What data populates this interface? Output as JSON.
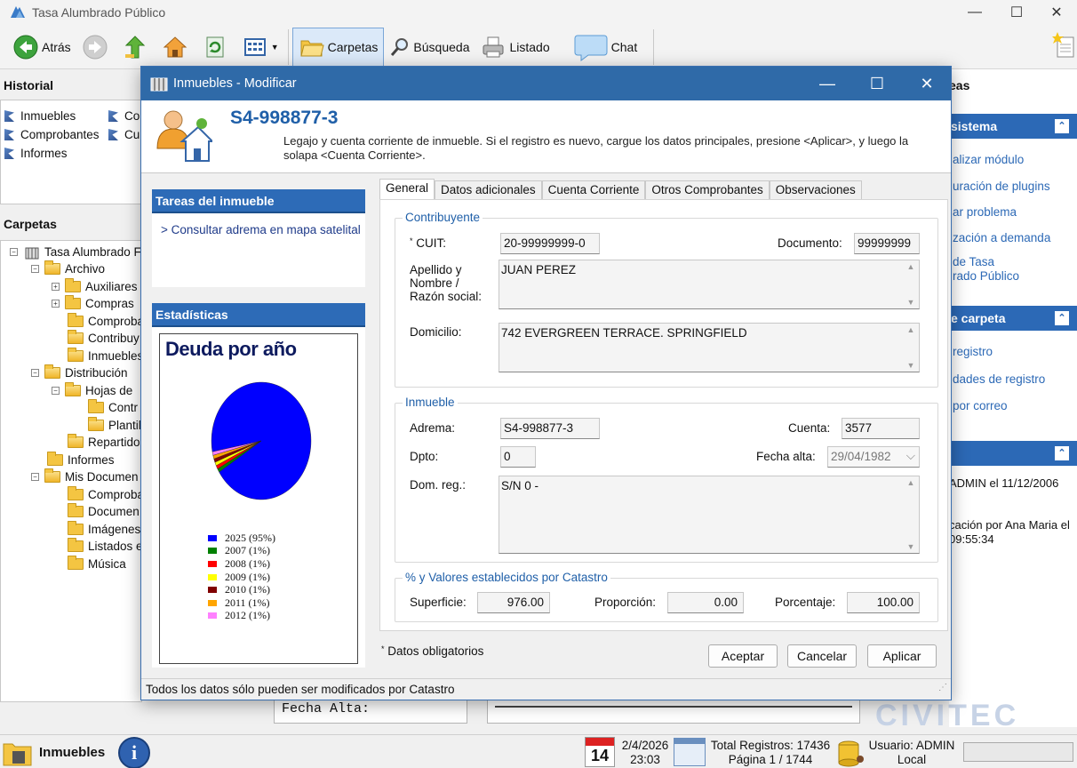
{
  "window": {
    "title": "Tasa Alumbrado Público"
  },
  "toolbar": {
    "back": "Atrás",
    "folders": "Carpetas",
    "search": "Búsqueda",
    "list": "Listado",
    "chat": "Chat"
  },
  "historial": {
    "title": "Historial",
    "items": [
      "Inmuebles",
      "Comprobantes",
      "Informes",
      "Co",
      "Cu"
    ]
  },
  "carpetas": {
    "title": "Carpetas",
    "tree": [
      {
        "label": "Tasa Alumbrado F",
        "expander": "−"
      },
      {
        "label": "Archivo",
        "expander": "−"
      },
      {
        "label": "Auxiliares",
        "expander": "+"
      },
      {
        "label": "Compras",
        "expander": "+"
      },
      {
        "label": "Comproba",
        "expander": ""
      },
      {
        "label": "Contribuy",
        "expander": ""
      },
      {
        "label": "Inmuebles",
        "expander": ""
      },
      {
        "label": "Distribución",
        "expander": "−"
      },
      {
        "label": "Hojas de",
        "expander": "−"
      },
      {
        "label": "Contr",
        "expander": ""
      },
      {
        "label": "Plantil",
        "expander": ""
      },
      {
        "label": "Repartido",
        "expander": ""
      },
      {
        "label": "Informes",
        "expander": ""
      },
      {
        "label": "Mis Documen",
        "expander": "−"
      },
      {
        "label": "Comproba",
        "expander": ""
      },
      {
        "label": "Documen",
        "expander": ""
      },
      {
        "label": "Imágenes",
        "expander": ""
      },
      {
        "label": "Listados e",
        "expander": ""
      },
      {
        "label": "Música",
        "expander": ""
      }
    ]
  },
  "right_panel": {
    "partial_title": "eas",
    "section1": {
      "title": "sistema",
      "links": [
        "alizar módulo",
        "uración de plugins",
        "ar problema",
        "zación a demanda",
        "de Tasa",
        "rado Público"
      ]
    },
    "section2": {
      "title": "e carpeta",
      "links": [
        "registro",
        "dades de registro",
        "por correo"
      ]
    },
    "section3": {
      "lines": [
        "ADMIN el 11/12/2006",
        "cación por Ana Maria el",
        "09:55:34"
      ]
    }
  },
  "background": {
    "field_label": "Fecha Alta:",
    "logo": "CIVITEC"
  },
  "statusbar": {
    "module": "Inmuebles",
    "calendar_day": "14",
    "date": "2/4/2026",
    "time": "23:03",
    "records": "Total Registros: 17436",
    "page": "Página 1 / 1744",
    "user": "Usuario: ADMIN",
    "location": "Local"
  },
  "dialog": {
    "title": "Inmuebles - Modificar",
    "heading": "S4-998877-3",
    "description": "Legajo y cuenta corriente de inmueble. Si el registro es nuevo, cargue los datos principales, presione <Aplicar>, y luego la solapa <Cuenta Corriente>.",
    "tasks": {
      "title": "Tareas del inmueble",
      "link": "> Consultar adrema en mapa satelital"
    },
    "stats": {
      "title": "Estadísticas"
    },
    "tabs": [
      "General",
      "Datos adicionales",
      "Cuenta Corriente",
      "Otros Comprobantes",
      "Observaciones"
    ],
    "contribuyente": {
      "title": "Contribuyente",
      "cuit_label": "CUIT:",
      "cuit": "20-99999999-0",
      "documento_label": "Documento:",
      "documento": "99999999",
      "nombre_label": "Apellido y Nombre / Razón social:",
      "nombre": "JUAN PEREZ",
      "domicilio_label": "Domicilio:",
      "domicilio": "742 EVERGREEN TERRACE. SPRINGFIELD"
    },
    "inmueble": {
      "title": "Inmueble",
      "adrema_label": "Adrema:",
      "adrema": "S4-998877-3",
      "cuenta_label": "Cuenta:",
      "cuenta": "3577",
      "dpto_label": "Dpto:",
      "dpto": "0",
      "fecha_label": "Fecha alta:",
      "fecha": "29/04/1982",
      "domreg_label": "Dom. reg.:",
      "domreg": "S/N 0 -"
    },
    "catastro": {
      "title": "% y Valores establecidos por Catastro",
      "superficie_label": "Superficie:",
      "superficie": "976.00",
      "proporcion_label": "Proporción:",
      "proporcion": "0.00",
      "porcentaje_label": "Porcentaje:",
      "porcentaje": "100.00"
    },
    "required_note": "Datos obligatorios",
    "buttons": {
      "accept": "Aceptar",
      "cancel": "Cancelar",
      "apply": "Aplicar"
    },
    "status": "Todos los datos sólo pueden ser modificados por Catastro"
  },
  "chart_data": {
    "type": "pie",
    "title": "Deuda por año",
    "slices": [
      {
        "label": "2025 (95%)",
        "value": 95,
        "color": "#0000ff"
      },
      {
        "label": "2007 (1%)",
        "value": 1,
        "color": "#008000"
      },
      {
        "label": "2008 (1%)",
        "value": 1,
        "color": "#ff0000"
      },
      {
        "label": "2009 (1%)",
        "value": 1,
        "color": "#ffff00"
      },
      {
        "label": "2010 (1%)",
        "value": 1,
        "color": "#800000"
      },
      {
        "label": "2011 (1%)",
        "value": 1,
        "color": "#ffa500"
      },
      {
        "label": "2012 (1%)",
        "value": 1,
        "color": "#ff80ff"
      }
    ]
  }
}
